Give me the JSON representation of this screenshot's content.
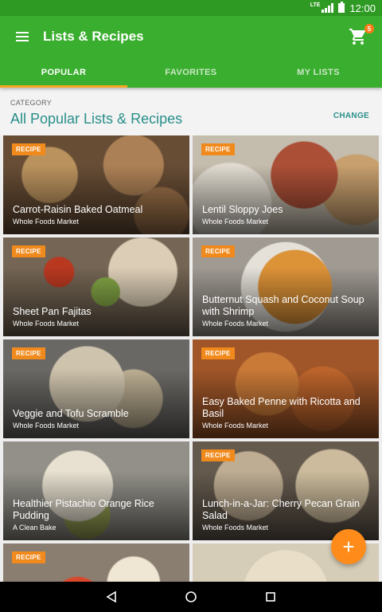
{
  "status_bar": {
    "network": "LTE",
    "time": "12:00"
  },
  "app_bar": {
    "title": "Lists & Recipes",
    "cart_count": "5"
  },
  "tabs": [
    {
      "label": "POPULAR",
      "active": true
    },
    {
      "label": "FAVORITES",
      "active": false
    },
    {
      "label": "MY LISTS",
      "active": false
    }
  ],
  "header": {
    "category_label": "CATEGORY",
    "category_title": "All Popular Lists & Recipes",
    "change_label": "CHANGE"
  },
  "cards": [
    {
      "badge": "RECIPE",
      "title": "Carrot-Raisin Baked Oatmeal",
      "source": "Whole Foods Market"
    },
    {
      "badge": "RECIPE",
      "title": "Lentil Sloppy Joes",
      "source": "Whole Foods Market"
    },
    {
      "badge": "RECIPE",
      "title": "Sheet Pan Fajitas",
      "source": "Whole Foods Market"
    },
    {
      "badge": "RECIPE",
      "title": "Butternut Squash and Coconut Soup with Shrimp",
      "source": "Whole Foods Market"
    },
    {
      "badge": "RECIPE",
      "title": "Veggie and Tofu Scramble",
      "source": "Whole Foods Market"
    },
    {
      "badge": "RECIPE",
      "title": "Easy Baked Penne with Ricotta and Basil",
      "source": "Whole Foods Market"
    },
    {
      "badge": "",
      "title": "Healthier Pistachio Orange Rice Pudding",
      "source": "A Clean Bake"
    },
    {
      "badge": "RECIPE",
      "title": "Lunch-in-a-Jar: Cherry Pecan Grain Salad",
      "source": "Whole Foods Market"
    },
    {
      "badge": "RECIPE",
      "title": "",
      "source": ""
    },
    {
      "badge": "",
      "title": "",
      "source": ""
    }
  ],
  "fab": {
    "label": "+"
  },
  "colors": {
    "primary": "#3aae2e",
    "status_bar": "#2e9a23",
    "accent": "#f5a623",
    "badge": "#f08a1c",
    "fab": "#ff8c1a",
    "link": "#2a8f8a"
  }
}
